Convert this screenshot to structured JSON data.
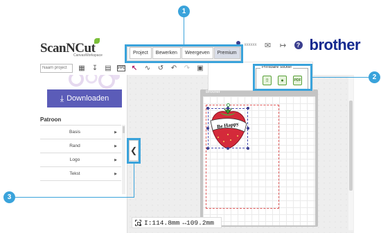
{
  "app": {
    "logo_text": "ScanNCut",
    "logo_sub": "CanvasWorkspace",
    "brand": "brother",
    "user_name": "xxxxxx"
  },
  "menu": {
    "tabs": [
      {
        "label": "Project",
        "active": false
      },
      {
        "label": "Bewerken",
        "active": false
      },
      {
        "label": "Weergeven",
        "active": false
      },
      {
        "label": "Premium",
        "active": true
      }
    ]
  },
  "toolbar": {
    "project_placeholder": "Naam project",
    "icons": [
      "new-project-icon",
      "download-icon",
      "open-folder-icon",
      "svg-import-icon",
      "select-arrow-icon",
      "draw-line-icon",
      "freehand-icon",
      "undo-icon",
      "redo-icon",
      "delete-icon"
    ]
  },
  "sticker": {
    "title": "Printbare sticker",
    "buttons": [
      "upload-sticker-icon",
      "ellipse-sticker-icon",
      "sticker-pdf-icon"
    ]
  },
  "left_panel": {
    "download_label": "Downloaden",
    "section_title": "Patroon",
    "categories": [
      {
        "label": "Basis"
      },
      {
        "label": "Rand"
      },
      {
        "label": "Logo"
      },
      {
        "label": "Tekst"
      }
    ]
  },
  "canvas": {
    "mat_brand": "brother",
    "object_text": "Be Happy",
    "width_readout": "I:114.8mm",
    "height_readout": "↔109.2mm"
  },
  "callouts": [
    "1",
    "2",
    "3"
  ],
  "colors": {
    "highlight": "#3aa3db",
    "download_button": "#5b5cb8",
    "brand": "#142a8f",
    "strawberry": "#d42a3a"
  }
}
